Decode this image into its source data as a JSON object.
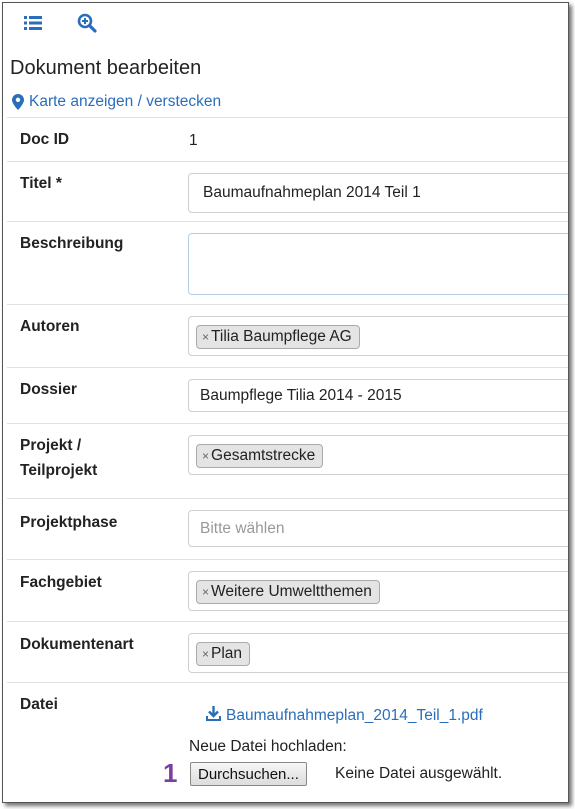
{
  "toolbar": {
    "list_icon": "list-icon",
    "zoom_icon": "zoom-in-icon"
  },
  "page": {
    "title": "Dokument bearbeiten",
    "map_toggle": "Karte anzeigen / verstecken"
  },
  "form": {
    "docid": {
      "label": "Doc ID",
      "value": "1"
    },
    "titel": {
      "label": "Titel *",
      "value": "Baumaufnahmeplan 2014 Teil 1"
    },
    "beschreibung": {
      "label": "Beschreibung",
      "value": ""
    },
    "autoren": {
      "label": "Autoren",
      "tag": "Tilia Baumpflege AG"
    },
    "dossier": {
      "label": "Dossier",
      "value": "Baumpflege Tilia 2014 - 2015"
    },
    "projekt": {
      "label_line1": "Projekt /",
      "label_line2": "Teilprojekt",
      "tag": "Gesamtstrecke"
    },
    "projektphase": {
      "label": "Projektphase",
      "placeholder": "Bitte wählen"
    },
    "fachgebiet": {
      "label": "Fachgebiet",
      "tag": "Weitere Umweltthemen"
    },
    "dokumentenart": {
      "label": "Dokumentenart",
      "tag": "Plan"
    },
    "datei": {
      "label": "Datei",
      "file_link": "Baumaufnahmeplan_2014_Teil_1.pdf",
      "upload_label": "Neue Datei hochladen:",
      "browse_button": "Durchsuchen...",
      "no_file_text": "Keine Datei ausgewählt.",
      "marker": "1"
    }
  },
  "colors": {
    "link": "#2a6ebb",
    "marker": "#7b3fa0",
    "tag_bg": "#e4e4e4"
  },
  "tag_remove_glyph": "×"
}
